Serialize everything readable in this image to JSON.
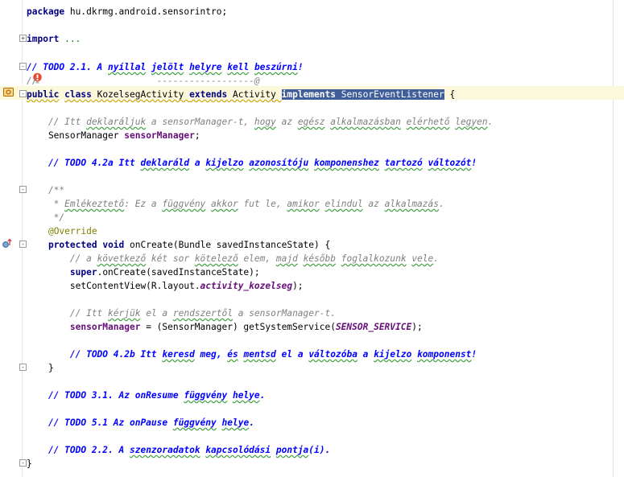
{
  "editor": {
    "lines": [
      {
        "id": "package",
        "parts": [
          {
            "t": "package",
            "c": "kw"
          },
          {
            "t": " hu.dkrmg.android.sensorintro;"
          }
        ]
      },
      {
        "id": "import",
        "parts": [
          {
            "t": "import",
            "c": "kw"
          },
          {
            "t": " "
          },
          {
            "t": "...",
            "c": "fold"
          }
        ]
      },
      {
        "id": "todo-2-1",
        "parts": [
          {
            "t": "// TODO 2.1. A ",
            "c": "todo"
          },
          {
            "t": "nyíllal",
            "c": "todo typo"
          },
          {
            "t": " ",
            "c": "todo"
          },
          {
            "t": "jelölt",
            "c": "todo typo"
          },
          {
            "t": " ",
            "c": "todo"
          },
          {
            "t": "helyre",
            "c": "todo typo"
          },
          {
            "t": " ",
            "c": "todo"
          },
          {
            "t": "kell",
            "c": "todo typo"
          },
          {
            "t": " ",
            "c": "todo"
          },
          {
            "t": "beszúrni",
            "c": "todo typo"
          },
          {
            "t": "!",
            "c": "todo"
          }
        ]
      },
      {
        "id": "arrow-comment",
        "parts": [
          {
            "t": "//",
            "c": "cm"
          },
          {
            "t": "                      ",
            "c": "cm"
          },
          {
            "t": "------------------@",
            "c": "cm"
          }
        ]
      },
      {
        "id": "class-decl",
        "parts": [
          {
            "t": "public",
            "c": "kw warn"
          },
          {
            "t": " "
          },
          {
            "t": "class",
            "c": "kw warn"
          },
          {
            "t": " KozelsegActivity ",
            "c": "warn"
          },
          {
            "t": "extends",
            "c": "kw warn"
          },
          {
            "t": " Activity ",
            "c": "warn"
          },
          {
            "t": "implements",
            "c": "kw sel"
          },
          {
            "t": " SensorEventListener",
            "c": "sel"
          },
          {
            "t": " {"
          }
        ]
      },
      {
        "id": "blank-1",
        "parts": []
      },
      {
        "id": "comment-decl",
        "parts": [
          {
            "t": "    // Itt ",
            "c": "cm"
          },
          {
            "t": "deklaráljuk",
            "c": "cm typo"
          },
          {
            "t": " a sensorManager-t, ",
            "c": "cm"
          },
          {
            "t": "hogy",
            "c": "cm typo"
          },
          {
            "t": " az ",
            "c": "cm"
          },
          {
            "t": "egész",
            "c": "cm typo"
          },
          {
            "t": " ",
            "c": "cm"
          },
          {
            "t": "alkalmazásban",
            "c": "cm typo"
          },
          {
            "t": " ",
            "c": "cm"
          },
          {
            "t": "elérhető",
            "c": "cm typo"
          },
          {
            "t": " ",
            "c": "cm"
          },
          {
            "t": "legyen",
            "c": "cm typo"
          },
          {
            "t": ".",
            "c": "cm"
          }
        ]
      },
      {
        "id": "field-decl",
        "parts": [
          {
            "t": "    SensorManager "
          },
          {
            "t": "sensorManager",
            "c": "fld"
          },
          {
            "t": ";"
          }
        ]
      },
      {
        "id": "blank-2",
        "parts": []
      },
      {
        "id": "todo-4-2a",
        "parts": [
          {
            "t": "    // TODO 4.2a Itt ",
            "c": "todo"
          },
          {
            "t": "deklaráld",
            "c": "todo typo"
          },
          {
            "t": " a ",
            "c": "todo"
          },
          {
            "t": "kijelzo",
            "c": "todo typo"
          },
          {
            "t": " ",
            "c": "todo"
          },
          {
            "t": "azonosítóju",
            "c": "todo typo"
          },
          {
            "t": " ",
            "c": "todo"
          },
          {
            "t": "komponenshez",
            "c": "todo typo"
          },
          {
            "t": " ",
            "c": "todo"
          },
          {
            "t": "tartozó",
            "c": "todo typo"
          },
          {
            "t": " ",
            "c": "todo"
          },
          {
            "t": "változót",
            "c": "todo typo"
          },
          {
            "t": "!",
            "c": "todo"
          }
        ]
      },
      {
        "id": "blank-3",
        "parts": []
      },
      {
        "id": "javadoc-open",
        "parts": [
          {
            "t": "    /**",
            "c": "cm"
          }
        ]
      },
      {
        "id": "javadoc-body",
        "parts": [
          {
            "t": "     * ",
            "c": "cm"
          },
          {
            "t": "Emlékeztető",
            "c": "cm typo"
          },
          {
            "t": ": Ez a ",
            "c": "cm"
          },
          {
            "t": "függvény",
            "c": "cm typo"
          },
          {
            "t": " ",
            "c": "cm"
          },
          {
            "t": "akkor",
            "c": "cm typo"
          },
          {
            "t": " fut le, ",
            "c": "cm"
          },
          {
            "t": "amikor",
            "c": "cm typo"
          },
          {
            "t": " ",
            "c": "cm"
          },
          {
            "t": "elindul",
            "c": "cm typo"
          },
          {
            "t": " az ",
            "c": "cm"
          },
          {
            "t": "alkalmazás",
            "c": "cm typo"
          },
          {
            "t": ".",
            "c": "cm"
          }
        ]
      },
      {
        "id": "javadoc-close",
        "parts": [
          {
            "t": "     */",
            "c": "cm"
          }
        ]
      },
      {
        "id": "override",
        "parts": [
          {
            "t": "    "
          },
          {
            "t": "@Override",
            "c": "ann"
          }
        ]
      },
      {
        "id": "oncreate-decl",
        "parts": [
          {
            "t": "    "
          },
          {
            "t": "protected",
            "c": "kw"
          },
          {
            "t": " "
          },
          {
            "t": "void",
            "c": "kw"
          },
          {
            "t": " onCreate(Bundle savedInstanceState) {"
          }
        ]
      },
      {
        "id": "comment-next",
        "parts": [
          {
            "t": "        // a ",
            "c": "cm"
          },
          {
            "t": "következő",
            "c": "cm typo"
          },
          {
            "t": " két sor ",
            "c": "cm"
          },
          {
            "t": "kötelező",
            "c": "cm typo"
          },
          {
            "t": " elem, ",
            "c": "cm"
          },
          {
            "t": "majd",
            "c": "cm typo"
          },
          {
            "t": " ",
            "c": "cm"
          },
          {
            "t": "később",
            "c": "cm typo"
          },
          {
            "t": " ",
            "c": "cm"
          },
          {
            "t": "foglalkozunk",
            "c": "cm typo"
          },
          {
            "t": " ",
            "c": "cm"
          },
          {
            "t": "vele",
            "c": "cm typo"
          },
          {
            "t": ".",
            "c": "cm"
          }
        ]
      },
      {
        "id": "super-call",
        "parts": [
          {
            "t": "        "
          },
          {
            "t": "super",
            "c": "kw"
          },
          {
            "t": ".onCreate(savedInstanceState);"
          }
        ]
      },
      {
        "id": "set-content",
        "parts": [
          {
            "t": "        setContentView(R.layout."
          },
          {
            "t": "activity_kozelseg",
            "c": "cst"
          },
          {
            "t": ");"
          }
        ]
      },
      {
        "id": "blank-4",
        "parts": []
      },
      {
        "id": "comment-ask",
        "parts": [
          {
            "t": "        // Itt ",
            "c": "cm"
          },
          {
            "t": "kérjük",
            "c": "cm typo"
          },
          {
            "t": " el a ",
            "c": "cm"
          },
          {
            "t": "rendszertől",
            "c": "cm typo"
          },
          {
            "t": " a sensorManager-t.",
            "c": "cm"
          }
        ]
      },
      {
        "id": "get-service",
        "parts": [
          {
            "t": "        "
          },
          {
            "t": "sensorManager",
            "c": "fld"
          },
          {
            "t": " = (SensorManager) getSystemService("
          },
          {
            "t": "SENSOR_SERVICE",
            "c": "cst"
          },
          {
            "t": ");"
          }
        ]
      },
      {
        "id": "blank-5",
        "parts": []
      },
      {
        "id": "todo-4-2b",
        "parts": [
          {
            "t": "        // TODO 4.2b Itt ",
            "c": "todo"
          },
          {
            "t": "keresd",
            "c": "todo typo"
          },
          {
            "t": " meg, ",
            "c": "todo"
          },
          {
            "t": "és",
            "c": "todo typo"
          },
          {
            "t": " ",
            "c": "todo"
          },
          {
            "t": "mentsd",
            "c": "todo typo"
          },
          {
            "t": " el a ",
            "c": "todo"
          },
          {
            "t": "változóba",
            "c": "todo typo"
          },
          {
            "t": " a ",
            "c": "todo"
          },
          {
            "t": "kijelzo",
            "c": "todo typo"
          },
          {
            "t": " ",
            "c": "todo"
          },
          {
            "t": "komponenst",
            "c": "todo typo"
          },
          {
            "t": "!",
            "c": "todo"
          }
        ]
      },
      {
        "id": "close-method",
        "parts": [
          {
            "t": "    }"
          }
        ]
      },
      {
        "id": "blank-6",
        "parts": []
      },
      {
        "id": "todo-3-1",
        "parts": [
          {
            "t": "    // TODO 3.1. Az onResume ",
            "c": "todo"
          },
          {
            "t": "függvény",
            "c": "todo typo"
          },
          {
            "t": " ",
            "c": "todo"
          },
          {
            "t": "helye",
            "c": "todo typo"
          },
          {
            "t": ".",
            "c": "todo"
          }
        ]
      },
      {
        "id": "blank-7",
        "parts": []
      },
      {
        "id": "todo-5-1",
        "parts": [
          {
            "t": "    // TODO 5.1 Az onPause ",
            "c": "todo"
          },
          {
            "t": "függvény",
            "c": "todo typo"
          },
          {
            "t": " ",
            "c": "todo"
          },
          {
            "t": "helye",
            "c": "todo typo"
          },
          {
            "t": ".",
            "c": "todo"
          }
        ]
      },
      {
        "id": "blank-8",
        "parts": []
      },
      {
        "id": "todo-2-2",
        "parts": [
          {
            "t": "    // TODO 2.2. A ",
            "c": "todo"
          },
          {
            "t": "szenzoradatok",
            "c": "todo typo"
          },
          {
            "t": " ",
            "c": "todo"
          },
          {
            "t": "kapcsolódási",
            "c": "todo typo"
          },
          {
            "t": " ",
            "c": "todo"
          },
          {
            "t": "pontja",
            "c": "todo typo"
          },
          {
            "t": "(i).",
            "c": "todo"
          }
        ]
      },
      {
        "id": "close-class",
        "parts": [
          {
            "t": "}"
          }
        ]
      }
    ]
  },
  "gutter": {
    "class_icon": "class-marker-icon",
    "warning_icon": "lightbulb-warning-icon",
    "override_icon": "override-marker-icon",
    "fold_expand_glyph": "+",
    "fold_collapse_glyph": "-"
  },
  "colors": {
    "keyword": "#000080",
    "comment": "#808080",
    "todo": "#0000ff",
    "selection": "#3f5e9a",
    "caret_row": "#fbf8dc"
  }
}
